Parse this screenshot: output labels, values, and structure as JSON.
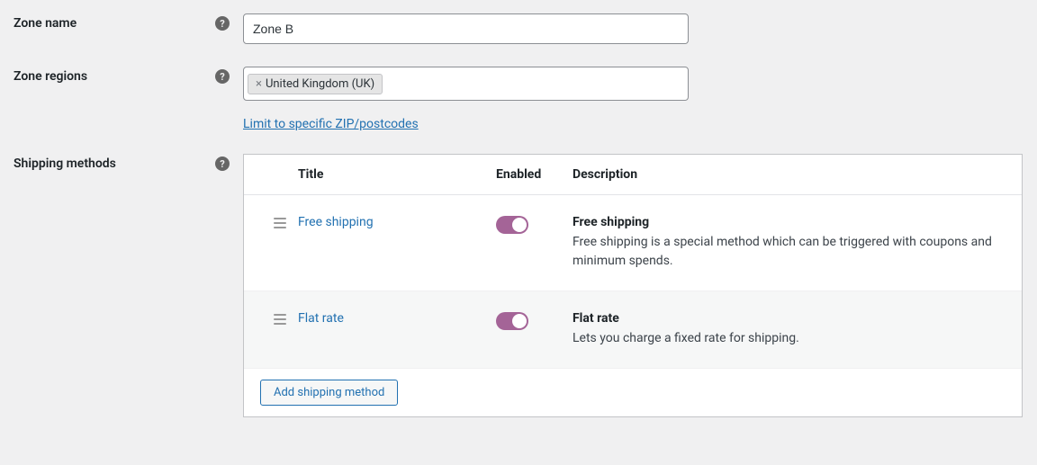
{
  "labels": {
    "zone_name": "Zone name",
    "zone_regions": "Zone regions",
    "shipping_methods": "Shipping methods"
  },
  "fields": {
    "zone_name_value": "Zone B",
    "zip_link": "Limit to specific ZIP/postcodes",
    "regions": [
      {
        "label": "United Kingdom (UK)"
      }
    ]
  },
  "table": {
    "headers": {
      "title": "Title",
      "enabled": "Enabled",
      "description": "Description"
    },
    "rows": [
      {
        "title": "Free shipping",
        "enabled": true,
        "desc_title": "Free shipping",
        "desc_text": "Free shipping is a special method which can be triggered with coupons and minimum spends."
      },
      {
        "title": "Flat rate",
        "enabled": true,
        "desc_title": "Flat rate",
        "desc_text": "Lets you charge a fixed rate for shipping."
      }
    ],
    "add_button": "Add shipping method"
  }
}
